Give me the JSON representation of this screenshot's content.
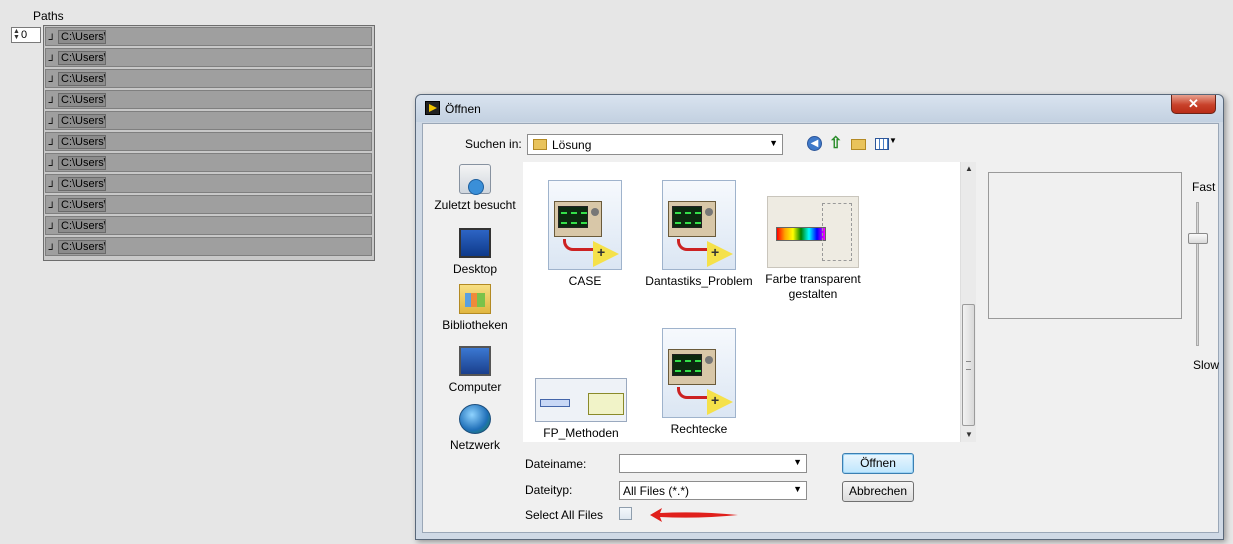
{
  "front_panel": {
    "paths_label": "Paths",
    "array_index": "0",
    "paths": [
      "C:\\Users\\",
      "C:\\Users\\",
      "C:\\Users\\",
      "C:\\Users\\",
      "C:\\Users\\",
      "C:\\Users\\",
      "C:\\Users\\",
      "C:\\Users\\",
      "C:\\Users\\",
      "C:\\Users\\",
      "C:\\Users\\"
    ]
  },
  "dialog": {
    "title": "Öffnen",
    "close_glyph": "✕",
    "look_in_label": "Suchen in:",
    "look_in_value": "Lösung",
    "places": [
      {
        "label": "Zuletzt besucht",
        "icon": "recent-places-icon"
      },
      {
        "label": "Desktop",
        "icon": "desktop-icon"
      },
      {
        "label": "Bibliotheken",
        "icon": "libraries-icon"
      },
      {
        "label": "Computer",
        "icon": "computer-icon"
      },
      {
        "label": "Netzwerk",
        "icon": "network-icon"
      }
    ],
    "files": [
      {
        "name": "CASE",
        "icon": "labview-vi-icon"
      },
      {
        "name": "Dantastiks_Problem",
        "icon": "labview-vi-icon"
      },
      {
        "name": "Farbe transparent gestalten",
        "icon": "image-thumbnail"
      },
      {
        "name": "FP_Methoden",
        "icon": "image-thumbnail"
      },
      {
        "name": "Rechtecke",
        "icon": "labview-vi-icon"
      }
    ],
    "preview": {
      "fast_label": "Fast",
      "slow_label": "Slow"
    },
    "filename_label": "Dateiname:",
    "filename_value": "",
    "filetype_label": "Dateityp:",
    "filetype_value": "All Files (*.*)",
    "open_button": "Öffnen",
    "cancel_button": "Abbrechen",
    "select_all_label": "Select All Files",
    "select_all_checked": false,
    "annotation_arrow_color": "#e0201c"
  }
}
